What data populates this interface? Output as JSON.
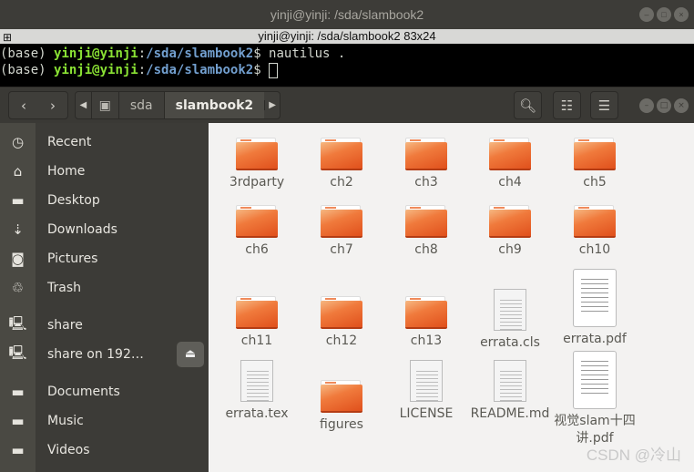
{
  "terminal": {
    "window_title": "yinji@yinji: /sda/slambook2",
    "tab_title": "yinji@yinji: /sda/slambook2 83x24",
    "lines": [
      {
        "env": "(base) ",
        "user": "yinji@yinji",
        "sep": ":",
        "path": "/sda/slambook2",
        "prompt": "$ ",
        "cmd": "nautilus ."
      },
      {
        "env": "(base) ",
        "user": "yinji@yinji",
        "sep": ":",
        "path": "/sda/slambook2",
        "prompt": "$ ",
        "cmd": ""
      }
    ]
  },
  "nautilus": {
    "breadcrumbs": [
      "sda",
      "slambook2"
    ],
    "sidebar": [
      {
        "label": "Recent",
        "icon": "clock-icon"
      },
      {
        "label": "Home",
        "icon": "home-icon"
      },
      {
        "label": "Desktop",
        "icon": "folder-icon"
      },
      {
        "label": "Downloads",
        "icon": "download-icon"
      },
      {
        "label": "Pictures",
        "icon": "camera-icon"
      },
      {
        "label": "Trash",
        "icon": "trash-icon"
      },
      {
        "label": "share",
        "icon": "network-icon"
      },
      {
        "label": "share on 192…",
        "icon": "network-icon"
      },
      {
        "label": "Documents",
        "icon": "folder-icon"
      },
      {
        "label": "Music",
        "icon": "folder-icon"
      },
      {
        "label": "Videos",
        "icon": "folder-icon"
      }
    ],
    "files": [
      {
        "name": "3rdparty",
        "type": "folder"
      },
      {
        "name": "ch2",
        "type": "folder"
      },
      {
        "name": "ch3",
        "type": "folder"
      },
      {
        "name": "ch4",
        "type": "folder"
      },
      {
        "name": "ch5",
        "type": "folder"
      },
      {
        "name": "ch6",
        "type": "folder"
      },
      {
        "name": "ch7",
        "type": "folder"
      },
      {
        "name": "ch8",
        "type": "folder"
      },
      {
        "name": "ch9",
        "type": "folder"
      },
      {
        "name": "ch10",
        "type": "folder"
      },
      {
        "name": "ch11",
        "type": "folder"
      },
      {
        "name": "ch12",
        "type": "folder"
      },
      {
        "name": "ch13",
        "type": "folder"
      },
      {
        "name": "errata.cls",
        "type": "text"
      },
      {
        "name": "errata.pdf",
        "type": "pdf"
      },
      {
        "name": "errata.tex",
        "type": "text"
      },
      {
        "name": "figures",
        "type": "folder"
      },
      {
        "name": "LICENSE",
        "type": "text"
      },
      {
        "name": "README.md",
        "type": "text"
      },
      {
        "name": "视觉slam十四讲.pdf",
        "type": "pdf"
      }
    ]
  },
  "watermark": "CSDN @冷山"
}
